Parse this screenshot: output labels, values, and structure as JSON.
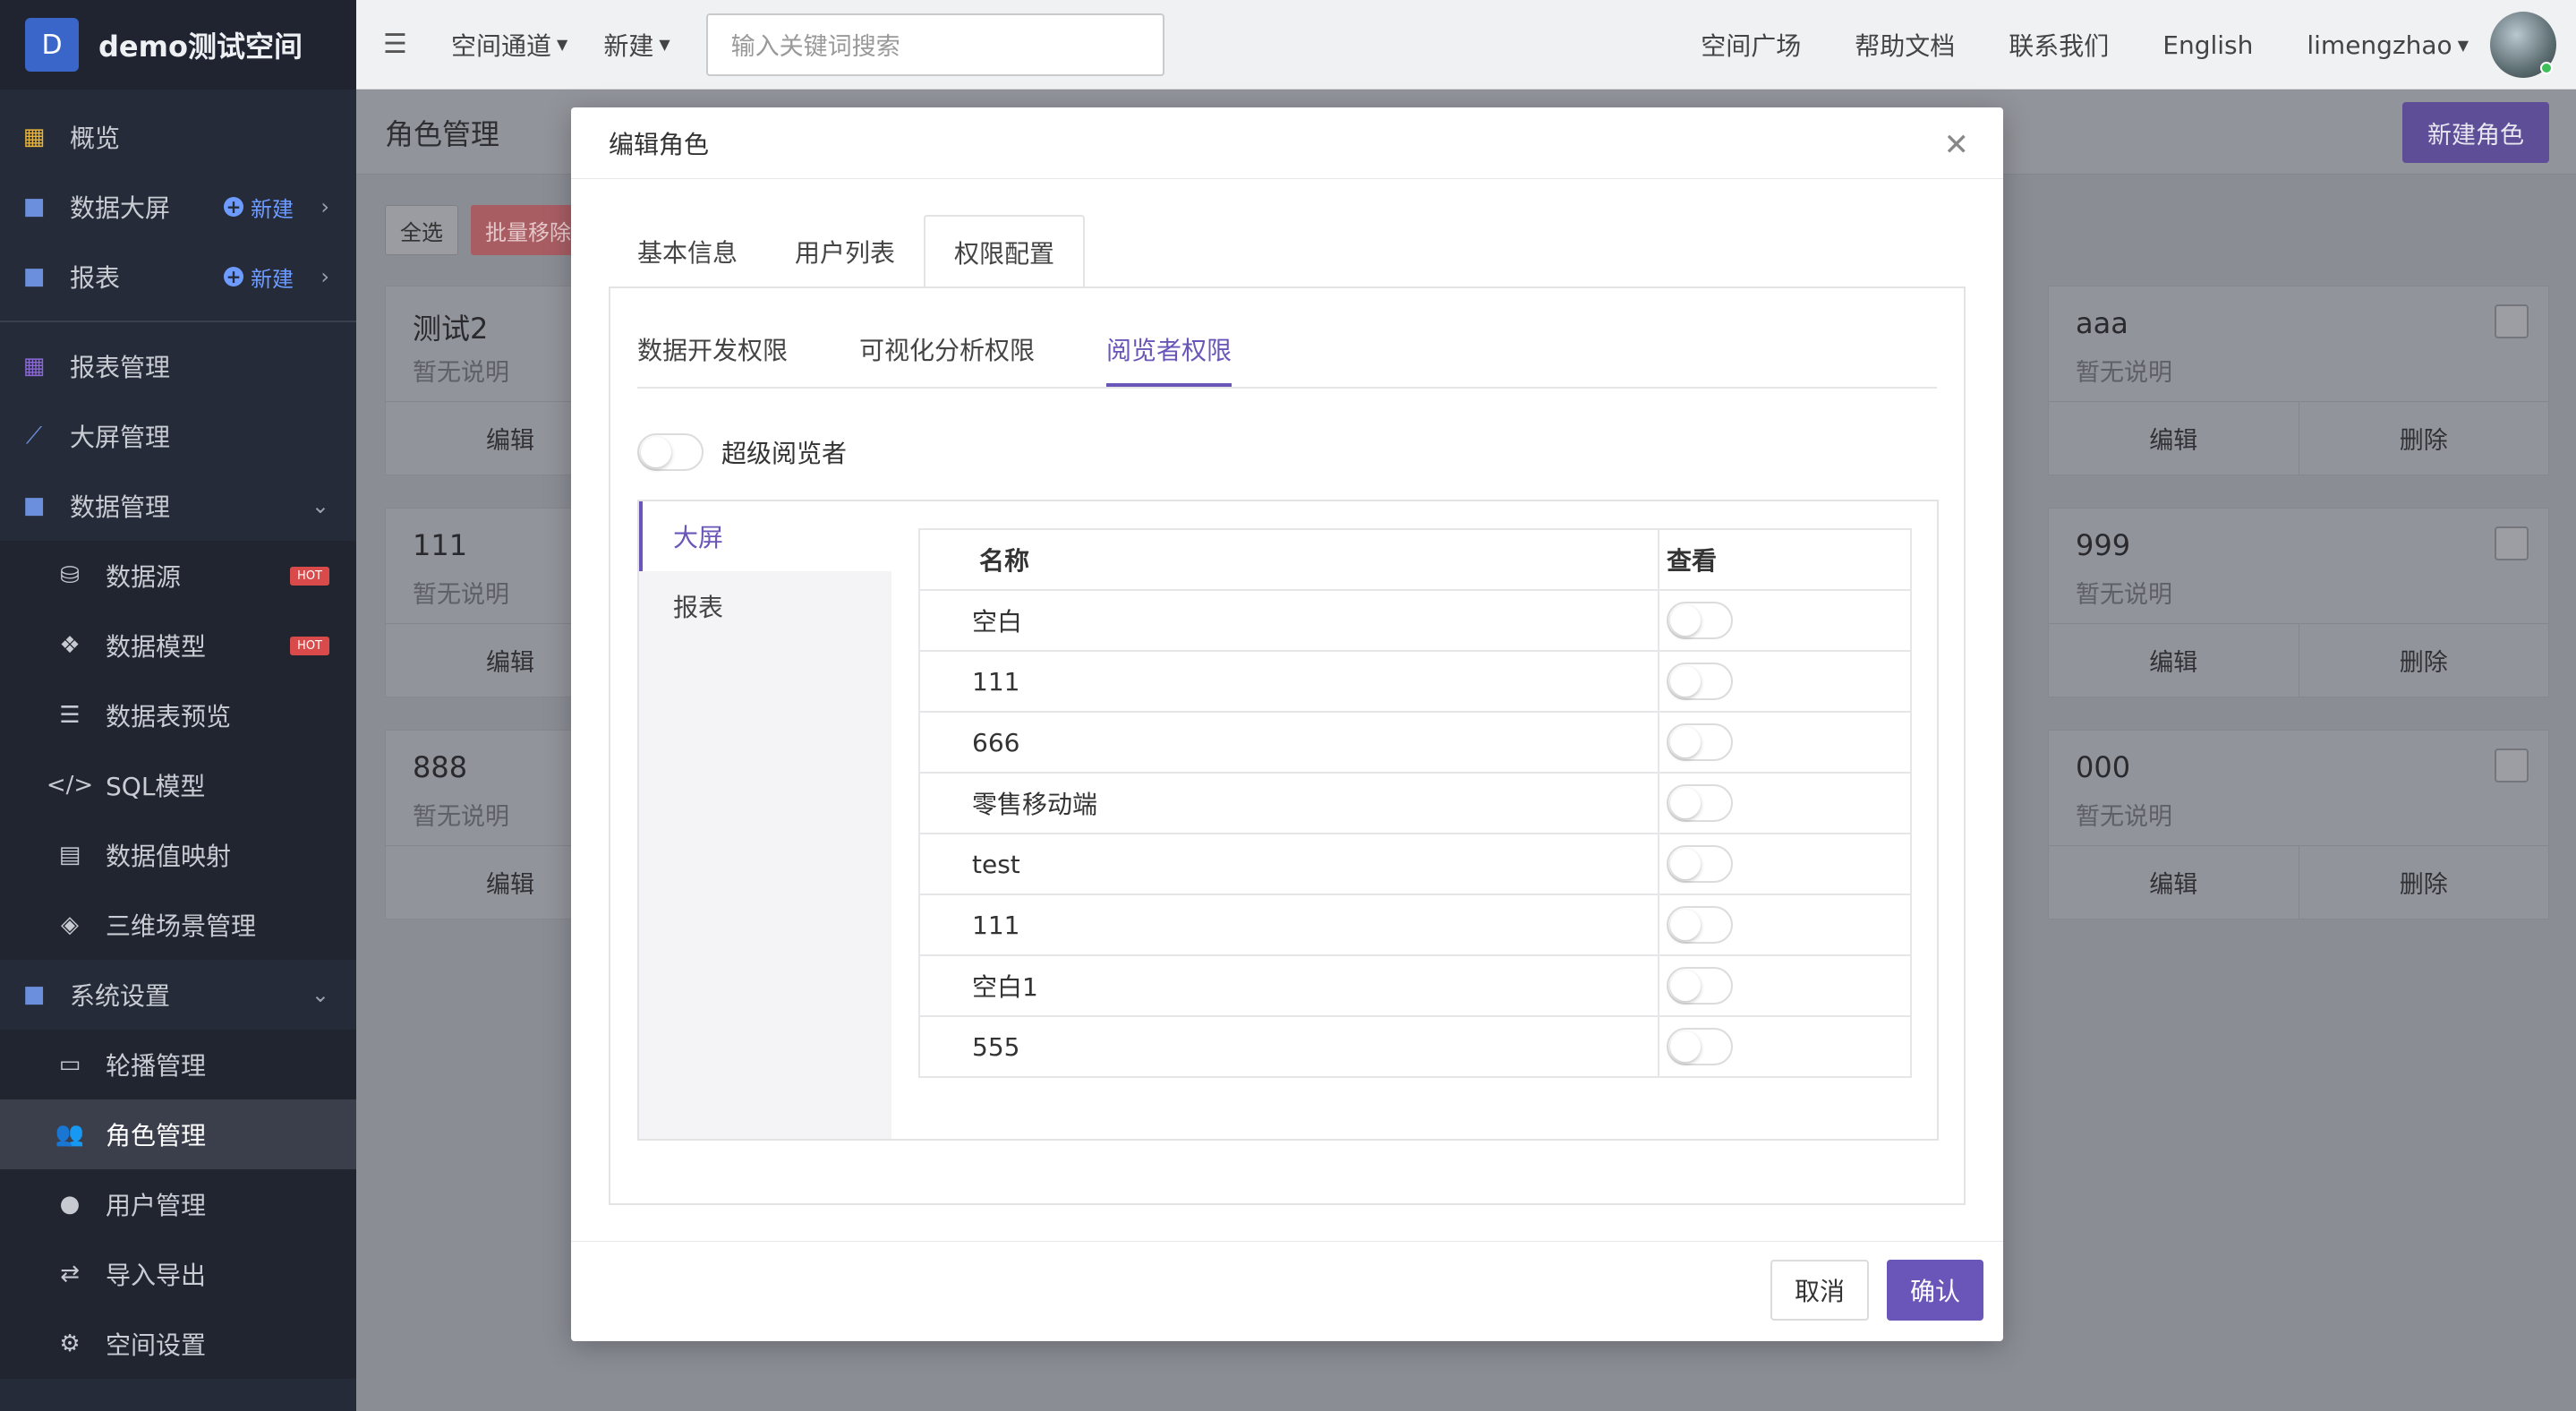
{
  "brand": {
    "logo_letter": "D",
    "name": "demo测试空间"
  },
  "sidebar": {
    "items": [
      {
        "label": "概览",
        "icon": "dashboard-grid-icon"
      },
      {
        "label": "数据大屏",
        "icon": "folder-icon",
        "new_label": "新建"
      },
      {
        "label": "报表",
        "icon": "folder-icon",
        "new_label": "新建"
      },
      {
        "label": "报表管理",
        "icon": "grid-icon"
      },
      {
        "label": "大屏管理",
        "icon": "chart-line-icon"
      },
      {
        "label": "数据管理",
        "icon": "folder-icon"
      },
      {
        "label": "数据源",
        "icon": "database-icon",
        "badge": "HOT"
      },
      {
        "label": "数据模型",
        "icon": "cubes-icon",
        "badge": "HOT"
      },
      {
        "label": "数据表预览",
        "icon": "list-icon"
      },
      {
        "label": "SQL模型",
        "icon": "code-icon"
      },
      {
        "label": "数据值映射",
        "icon": "book-icon"
      },
      {
        "label": "三维场景管理",
        "icon": "cube-icon"
      },
      {
        "label": "系统设置",
        "icon": "folder-icon"
      },
      {
        "label": "轮播管理",
        "icon": "monitor-icon"
      },
      {
        "label": "角色管理",
        "icon": "users-icon"
      },
      {
        "label": "用户管理",
        "icon": "user-icon"
      },
      {
        "label": "导入导出",
        "icon": "exchange-icon"
      },
      {
        "label": "空间设置",
        "icon": "gear-icon"
      }
    ]
  },
  "header": {
    "space_channel": "空间通道",
    "new": "新建",
    "search_placeholder": "输入关键词搜索",
    "links": [
      "空间广场",
      "帮助文档",
      "联系我们",
      "English"
    ],
    "username": "limengzhao"
  },
  "page": {
    "title": "角色管理",
    "new_role_button": "新建角色",
    "select_all": "全选",
    "batch_remove": "批量移除",
    "cards_left": [
      {
        "title": "测试2",
        "desc": "暂无说明",
        "edit": "编辑"
      },
      {
        "title": "111",
        "desc": "暂无说明",
        "edit": "编辑"
      },
      {
        "title": "888",
        "desc": "暂无说明",
        "edit": "编辑"
      }
    ],
    "cards_right": [
      {
        "title": "aaa",
        "desc": "暂无说明",
        "edit": "编辑",
        "delete": "删除"
      },
      {
        "title": "999",
        "desc": "暂无说明",
        "edit": "编辑",
        "delete": "删除"
      },
      {
        "title": "000",
        "desc": "暂无说明",
        "edit": "编辑",
        "delete": "删除"
      }
    ]
  },
  "modal": {
    "title": "编辑角色",
    "tabs": [
      "基本信息",
      "用户列表",
      "权限配置"
    ],
    "active_tab": "权限配置",
    "subtabs": [
      "数据开发权限",
      "可视化分析权限",
      "阅览者权限"
    ],
    "active_subtab": "阅览者权限",
    "super_viewer_label": "超级阅览者",
    "super_viewer_on": false,
    "perm_side": [
      "大屏",
      "报表"
    ],
    "table": {
      "col_name": "名称",
      "col_view": "查看",
      "rows": [
        {
          "name": "空白",
          "view": false
        },
        {
          "name": "111",
          "view": false
        },
        {
          "name": "666",
          "view": false
        },
        {
          "name": "零售移动端",
          "view": false
        },
        {
          "name": "test",
          "view": false
        },
        {
          "name": "111",
          "view": false
        },
        {
          "name": "空白1",
          "view": false
        },
        {
          "name": "555",
          "view": false
        }
      ]
    },
    "cancel": "取消",
    "confirm": "确认"
  },
  "colors": {
    "accent": "#6a55b8",
    "sidebar_bg": "#252b38",
    "brand_logo": "#3b66c9",
    "hot_badge": "#d94b4b"
  }
}
